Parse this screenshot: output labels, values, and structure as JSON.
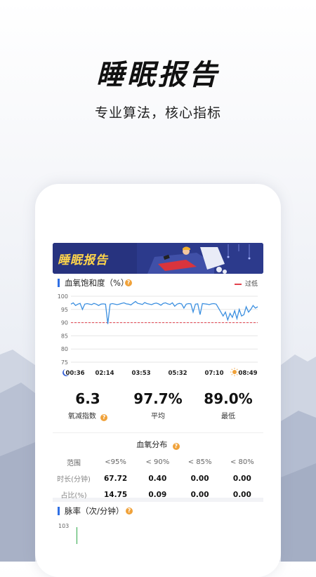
{
  "hero": {
    "title": "睡眠报告",
    "subtitle": "专业算法，核心指标"
  },
  "banner": {
    "title": "睡眠报告"
  },
  "spo2_section": {
    "title": "血氧饱和度（%）",
    "legend_label": "过低",
    "help_icon": "question-icon"
  },
  "chart_data": {
    "type": "line",
    "title": "血氧饱和度（%）",
    "yticks": [
      100,
      95,
      90,
      85,
      80,
      75
    ],
    "ylim": [
      75,
      100
    ],
    "xticks": [
      "00:36",
      "02:14",
      "03:53",
      "05:32",
      "07:10",
      "08:49"
    ],
    "threshold": 90,
    "threshold_label": "过低",
    "series": [
      {
        "values": [
          97,
          97.5,
          96.5,
          97,
          97.3,
          95,
          97,
          97.2,
          97,
          96.8,
          97.3,
          97,
          96.5,
          97,
          97.1,
          97,
          89.5,
          97,
          97.2,
          97,
          96.8,
          97,
          97.3,
          97.5,
          97.1,
          97,
          96.7,
          97.4,
          98,
          97.3,
          97.1,
          96.9,
          97.6,
          97.2,
          97,
          96.8,
          97.2,
          97.4,
          97.1,
          96.6,
          97.3,
          97.5,
          97.1,
          96.9,
          97.5,
          96.2,
          97,
          97.3,
          97.1,
          95.5,
          97,
          97.2,
          97.1,
          94,
          97,
          97.1,
          93,
          97.2,
          97.1,
          97,
          96.8,
          97.1,
          97.2,
          97,
          95.5,
          94,
          92.5,
          94,
          91,
          93.5,
          92,
          94.5,
          91.5,
          95,
          92.5,
          93,
          96,
          94,
          95,
          96.5,
          95.5,
          96
        ]
      }
    ]
  },
  "stats": [
    {
      "value": "6.3",
      "label": "氧减指数",
      "has_help": true
    },
    {
      "value": "97.7%",
      "label": "平均",
      "has_help": false
    },
    {
      "value": "89.0%",
      "label": "最低",
      "has_help": false
    }
  ],
  "distribution": {
    "title": "血氧分布",
    "headers": [
      "范围",
      "<95%",
      "< 90%",
      "< 85%",
      "< 80%"
    ],
    "duration_label": "时长(分钟)",
    "duration_values": [
      "67.72",
      "0.40",
      "0.00",
      "0.00"
    ],
    "ratio_label": "占比(%)",
    "ratio_values": [
      "14.75",
      "0.09",
      "0.00",
      "0.00"
    ]
  },
  "pulse_section": {
    "title": "脉率（次/分钟）",
    "ytick_top": "103"
  },
  "colors": {
    "accent": "#2f6fe4",
    "line": "#3b8fe0",
    "threshold": "#e2424d",
    "help": "#f0a23a",
    "banner": "#24307a"
  }
}
